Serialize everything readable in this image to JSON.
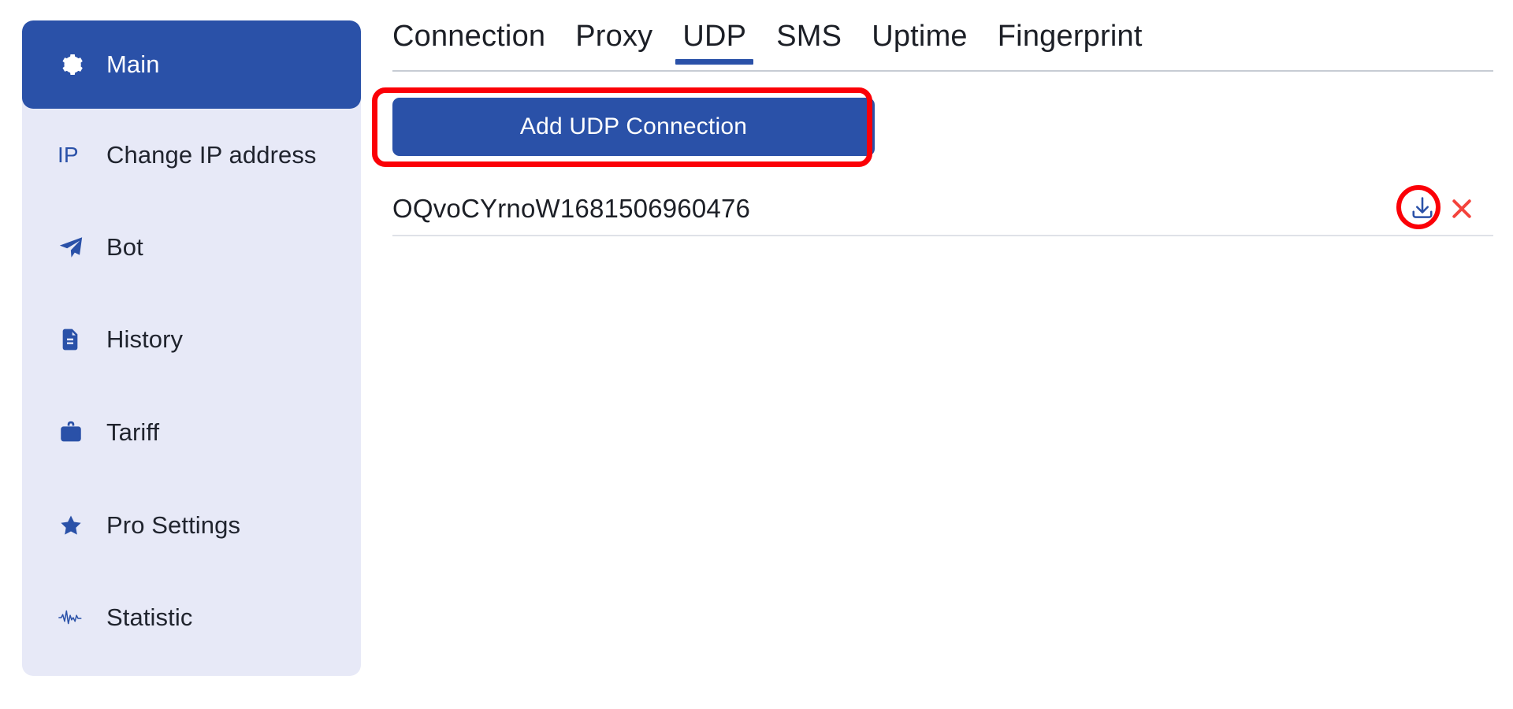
{
  "colors": {
    "brand_blue": "#2a51a8",
    "sidebar_bg": "#e7e9f7",
    "annotation_red": "#fb0007",
    "delete_red": "#f4433c",
    "text_dark": "#1c1f26",
    "divider": "#c7ccd4"
  },
  "sidebar": {
    "items": [
      {
        "label": "Main",
        "icon": "gear-icon",
        "active": true
      },
      {
        "label": "Change IP address",
        "icon": "ip-text-icon",
        "active": false
      },
      {
        "label": "Bot",
        "icon": "send-icon",
        "active": false
      },
      {
        "label": "History",
        "icon": "document-icon",
        "active": false
      },
      {
        "label": "Tariff",
        "icon": "briefcase-icon",
        "active": false
      },
      {
        "label": "Pro Settings",
        "icon": "star-icon",
        "active": false
      },
      {
        "label": "Statistic",
        "icon": "activity-icon",
        "active": false
      }
    ],
    "ip_icon_text": "IP"
  },
  "main": {
    "tabs": [
      {
        "label": "Connection",
        "active": false
      },
      {
        "label": "Proxy",
        "active": false
      },
      {
        "label": "UDP",
        "active": true
      },
      {
        "label": "SMS",
        "active": false
      },
      {
        "label": "Uptime",
        "active": false
      },
      {
        "label": "Fingerprint",
        "active": false
      }
    ],
    "add_button_label": "Add UDP Connection",
    "connections": [
      {
        "name": "OQvoCYrnoW1681506960476",
        "download_icon": "download-icon",
        "delete_icon": "close-x-icon"
      }
    ]
  }
}
